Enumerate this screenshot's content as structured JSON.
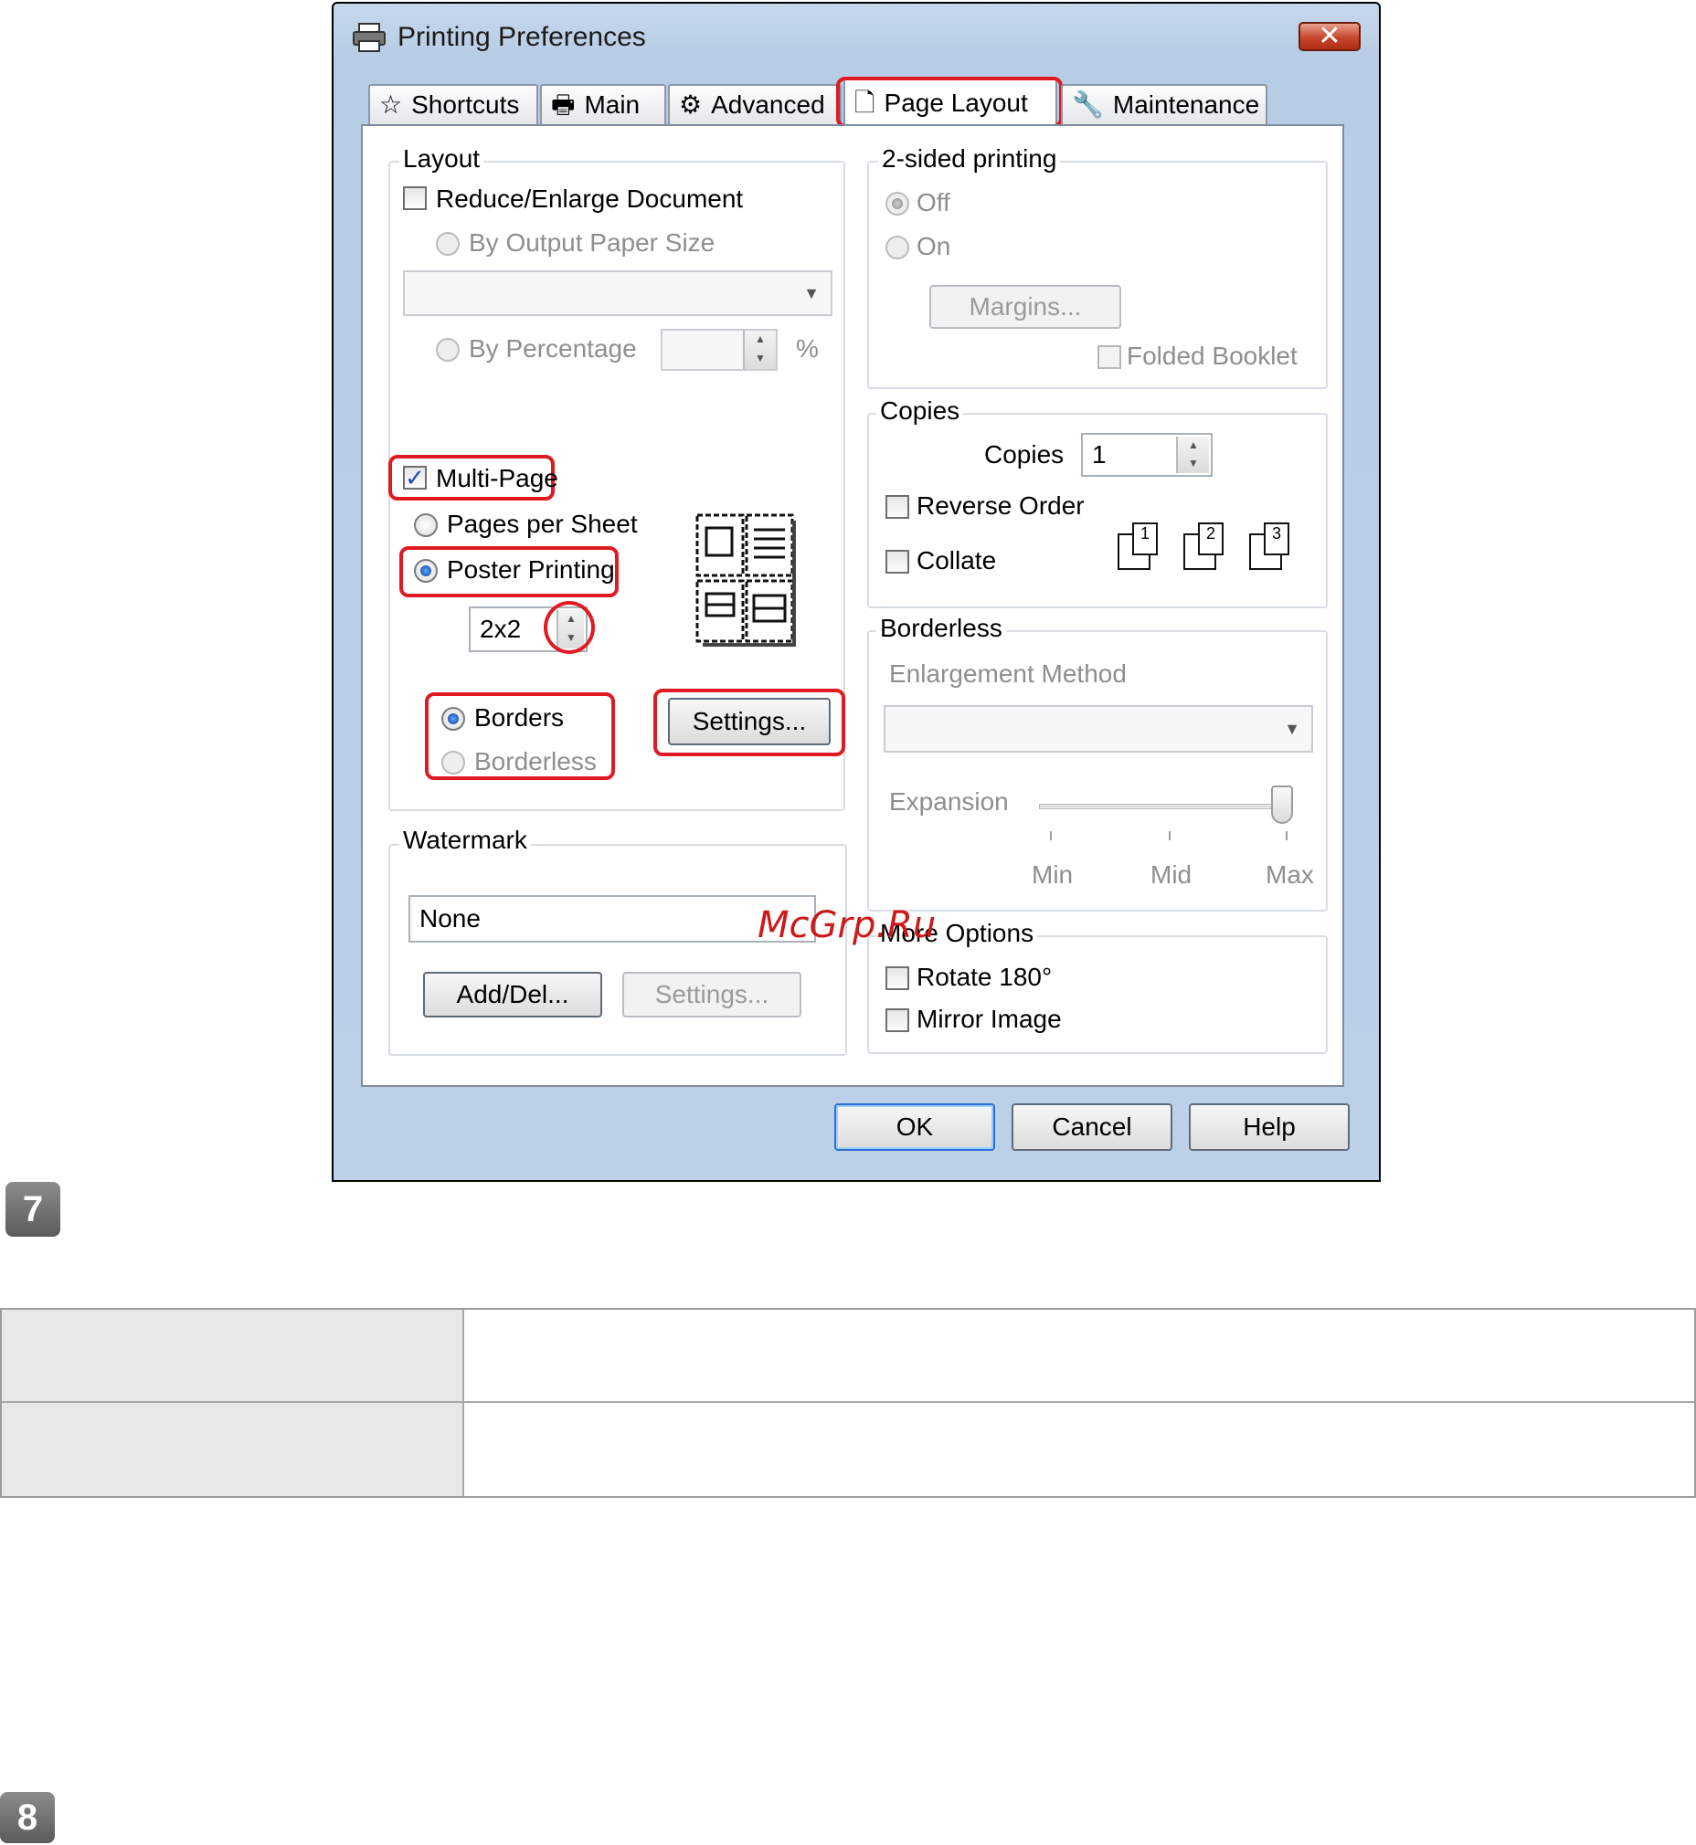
{
  "window": {
    "title": "Printing Preferences",
    "close_symbol": "✕"
  },
  "tabs": [
    {
      "label": "Shortcuts",
      "icon": "star-icon"
    },
    {
      "label": "Main",
      "icon": "printer-icon"
    },
    {
      "label": "Advanced",
      "icon": "gear-printer-icon"
    },
    {
      "label": "Page Layout",
      "icon": "page-icon"
    },
    {
      "label": "Maintenance",
      "icon": "wrench-icon"
    }
  ],
  "layout": {
    "legend": "Layout",
    "reduce_enlarge": "Reduce/Enlarge Document",
    "by_output_paper_size": "By Output Paper Size",
    "by_percentage": "By Percentage",
    "percent_symbol": "%",
    "multi_page": "Multi-Page",
    "pages_per_sheet": "Pages per Sheet",
    "poster_printing": "Poster Printing",
    "poster_value": "2x2",
    "borders": "Borders",
    "borderless": "Borderless",
    "settings_button": "Settings..."
  },
  "two_sided": {
    "legend": "2-sided printing",
    "off": "Off",
    "on": "On",
    "margins_button": "Margins...",
    "folded_booklet": "Folded Booklet"
  },
  "copies": {
    "legend": "Copies",
    "label": "Copies",
    "value": "1",
    "reverse_order": "Reverse Order",
    "collate": "Collate",
    "collate_pages": [
      "1",
      "2",
      "3"
    ]
  },
  "borderless": {
    "legend": "Borderless",
    "enlargement_method": "Enlargement Method",
    "expansion": "Expansion",
    "expansion_level": 1.0,
    "min": "Min",
    "mid": "Mid",
    "max": "Max"
  },
  "watermark": {
    "legend": "Watermark",
    "value": "None",
    "add_del_button": "Add/Del...",
    "settings_button": "Settings..."
  },
  "more_options": {
    "legend": "More Options",
    "rotate": "Rotate 180°",
    "mirror": "Mirror Image"
  },
  "footer": {
    "ok": "OK",
    "cancel": "Cancel",
    "help": "Help"
  },
  "watermark_text": "McGrp.Ru",
  "steps": [
    "7",
    "8"
  ],
  "colors": {
    "highlight_red": "#e01a22",
    "watermark_red": "#cc1a1a"
  }
}
